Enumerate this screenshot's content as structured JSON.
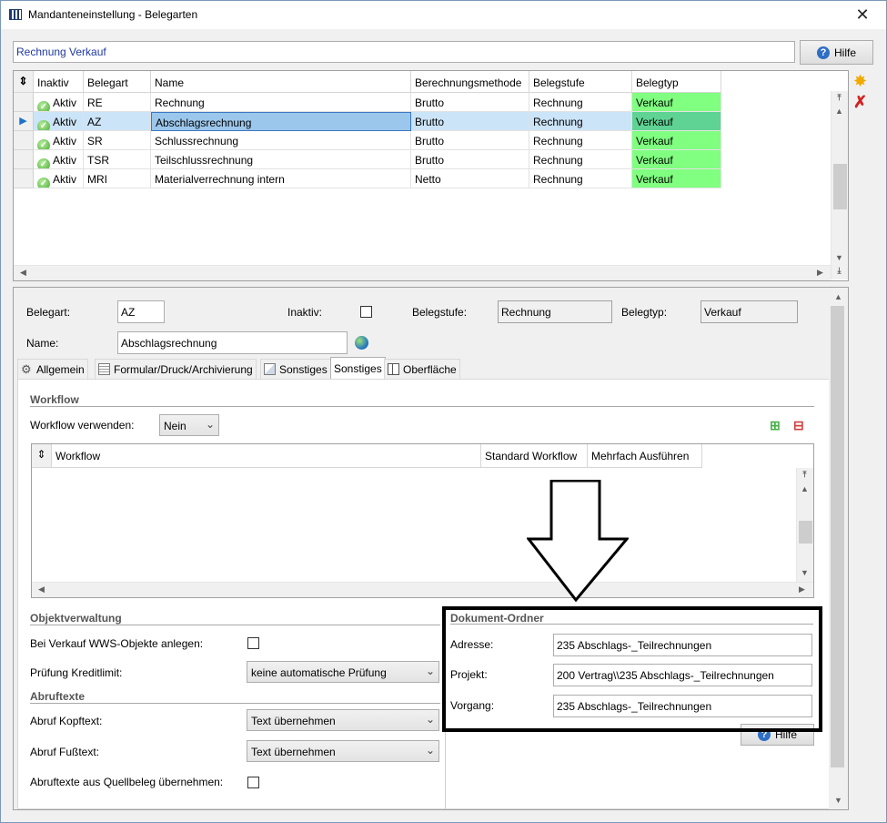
{
  "window": {
    "title": "Mandanteneinstellung - Belegarten",
    "close_glyph": "✕"
  },
  "search": {
    "value": "Rechnung Verkauf"
  },
  "help_button": {
    "label": "Hilfe"
  },
  "side_tools": {
    "add": "✸",
    "delete": "✗"
  },
  "grid": {
    "columns": [
      "Inaktiv",
      "Belegart",
      "Name",
      "Berechnungsmethode",
      "Belegstufe",
      "Belegtyp"
    ],
    "rows": [
      {
        "inaktiv": "Aktiv",
        "belegart": "RE",
        "name": "Rechnung",
        "methode": "Brutto",
        "stufe": "Rechnung",
        "typ": "Verkauf"
      },
      {
        "inaktiv": "Aktiv",
        "belegart": "AZ",
        "name": "Abschlagsrechnung",
        "methode": "Brutto",
        "stufe": "Rechnung",
        "typ": "Verkauf"
      },
      {
        "inaktiv": "Aktiv",
        "belegart": "SR",
        "name": "Schlussrechnung",
        "methode": "Brutto",
        "stufe": "Rechnung",
        "typ": "Verkauf"
      },
      {
        "inaktiv": "Aktiv",
        "belegart": "TSR",
        "name": "Teilschlussrechnung",
        "methode": "Brutto",
        "stufe": "Rechnung",
        "typ": "Verkauf"
      },
      {
        "inaktiv": "Aktiv",
        "belegart": "MRI",
        "name": "Materialverrechnung intern",
        "methode": "Netto",
        "stufe": "Rechnung",
        "typ": "Verkauf"
      }
    ],
    "selected_row": 1
  },
  "detail": {
    "belegart_label": "Belegart:",
    "belegart_value": "AZ",
    "inaktiv_label": "Inaktiv:",
    "belegstufe_label": "Belegstufe:",
    "belegstufe_value": "Rechnung",
    "belegtyp_label": "Belegtyp:",
    "belegtyp_value": "Verkauf",
    "name_label": "Name:",
    "name_value": "Abschlagsrechnung"
  },
  "tabs": [
    "Allgemein",
    "Formular/Druck/Archivierung",
    "Sonstiges",
    "Sonstiges",
    "Oberfläche"
  ],
  "active_tab": 3,
  "workflow": {
    "section": "Workflow",
    "use_label": "Workflow verwenden:",
    "use_value": "Nein",
    "columns": [
      "Workflow",
      "Standard Workflow",
      "Mehrfach Ausführen"
    ]
  },
  "objekt": {
    "section": "Objektverwaltung",
    "wws_label": "Bei Verkauf WWS-Objekte anlegen:",
    "kredit_label": "Prüfung Kreditlimit:",
    "kredit_value": "keine automatische Prüfung"
  },
  "abruf": {
    "section": "Abruftexte",
    "kopf_label": "Abruf Kopftext:",
    "kopf_value": "Text übernehmen",
    "fuss_label": "Abruf Fußtext:",
    "fuss_value": "Text übernehmen",
    "quell_label": "Abruftexte aus Quellbeleg übernehmen:"
  },
  "dokument": {
    "section": "Dokument-Ordner",
    "adresse_label": "Adresse:",
    "adresse_value": "235 Abschlags-_Teilrechnungen",
    "projekt_label": "Projekt:",
    "projekt_value": "200 Vertrag\\\\235 Abschlags-_Teilrechnungen",
    "vorgang_label": "Vorgang:",
    "vorgang_value": "235 Abschlags-_Teilrechnungen",
    "hilfe_label": "Hilfe"
  }
}
